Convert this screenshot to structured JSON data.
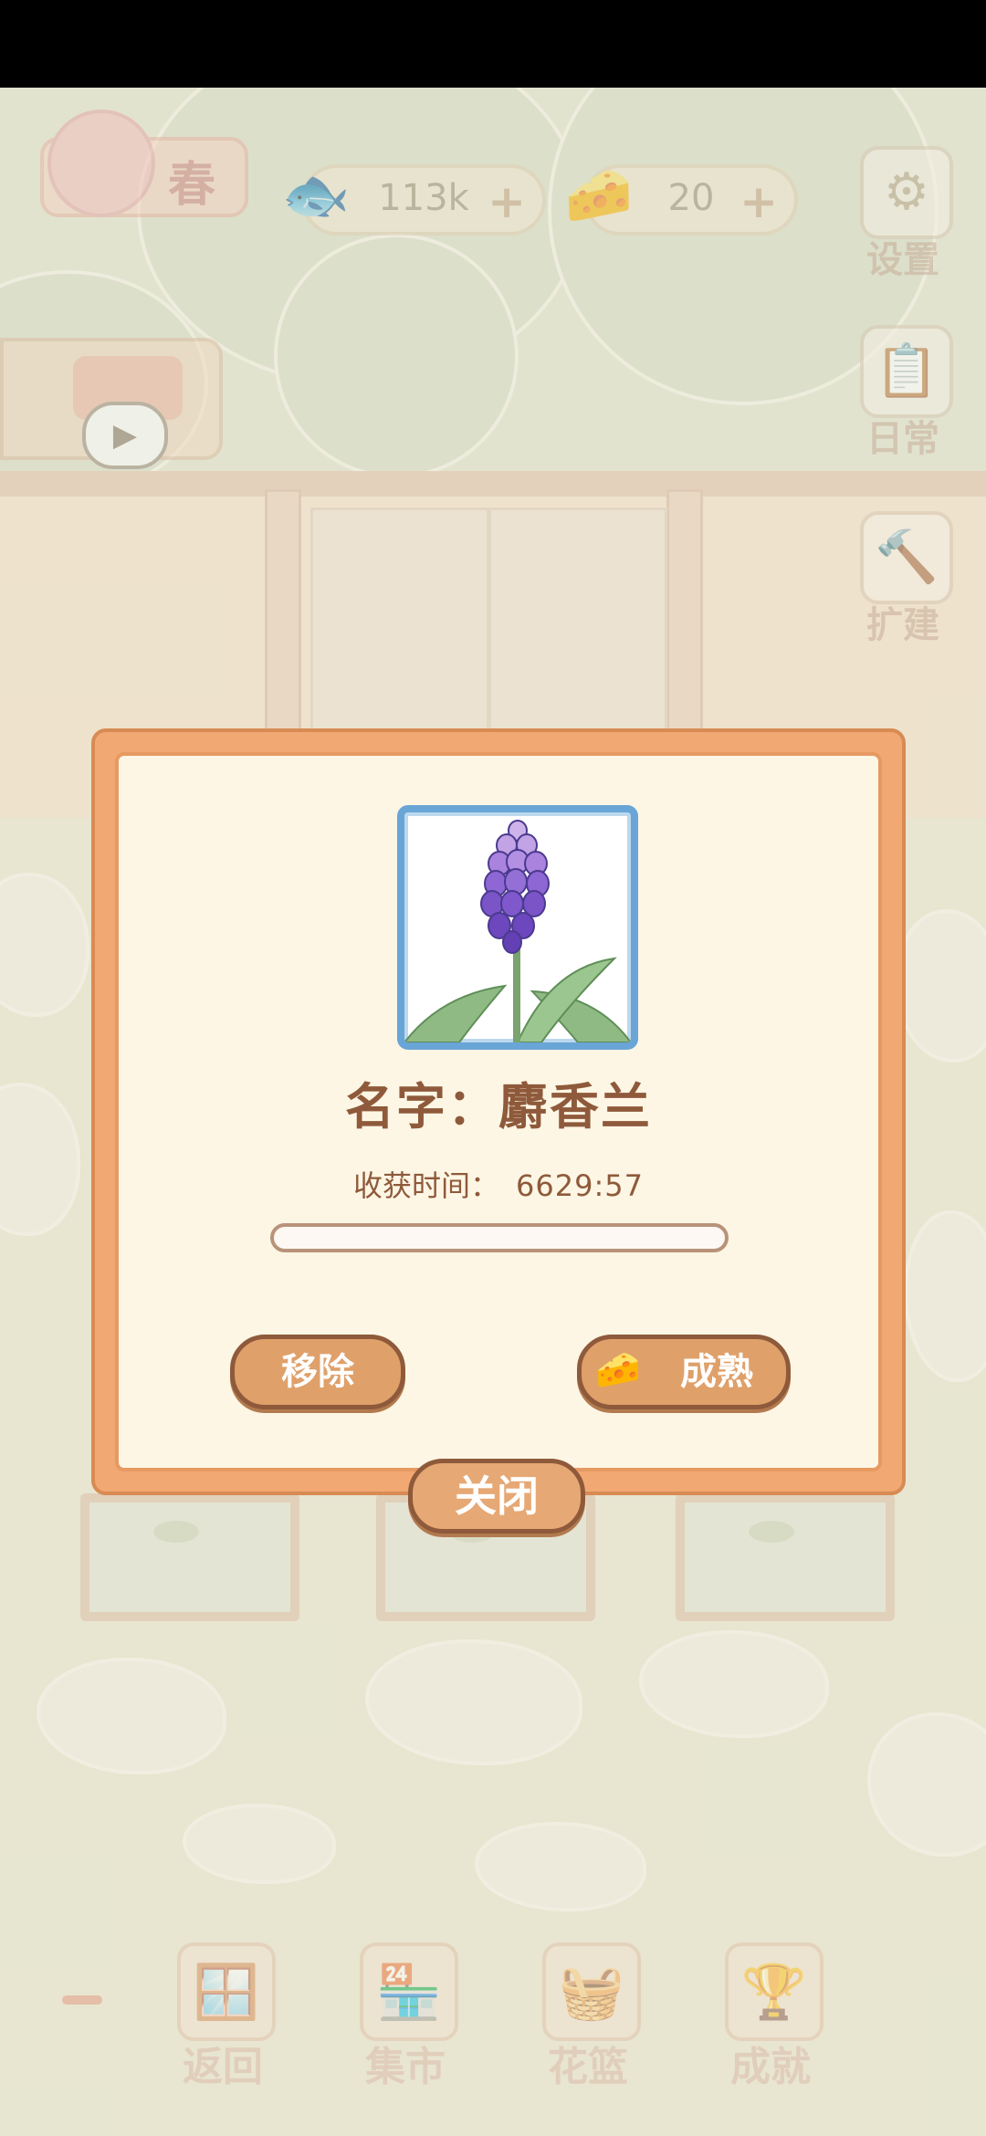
{
  "hud": {
    "season_label": "春",
    "fish_amount": "113k",
    "cheese_amount": "20",
    "plus": "+",
    "settings_label": "设置",
    "daily_label": "日常",
    "expand_label": "扩建"
  },
  "dialog": {
    "name_label": "名字：麝香兰",
    "harvest_label": "收获时间：",
    "harvest_time": "6629:57",
    "progress": 0.0,
    "remove_label": "移除",
    "ripen_label": "成熟",
    "close_label": "关闭"
  },
  "bottom_nav": [
    {
      "label": "返回"
    },
    {
      "label": "集市"
    },
    {
      "label": "花篮"
    },
    {
      "label": "成就"
    }
  ],
  "colors": {
    "accent_orange": "#f2a872",
    "panel_cream": "#fdf6e4",
    "text_brown": "#8e5a3b",
    "frame_blue": "#69a5d6"
  },
  "icons": [
    "fish-bone-icon",
    "cheese-icon",
    "gear-icon",
    "clipboard-icon",
    "hammer-icon",
    "watering-can-icon",
    "play-icon",
    "flower-image"
  ]
}
